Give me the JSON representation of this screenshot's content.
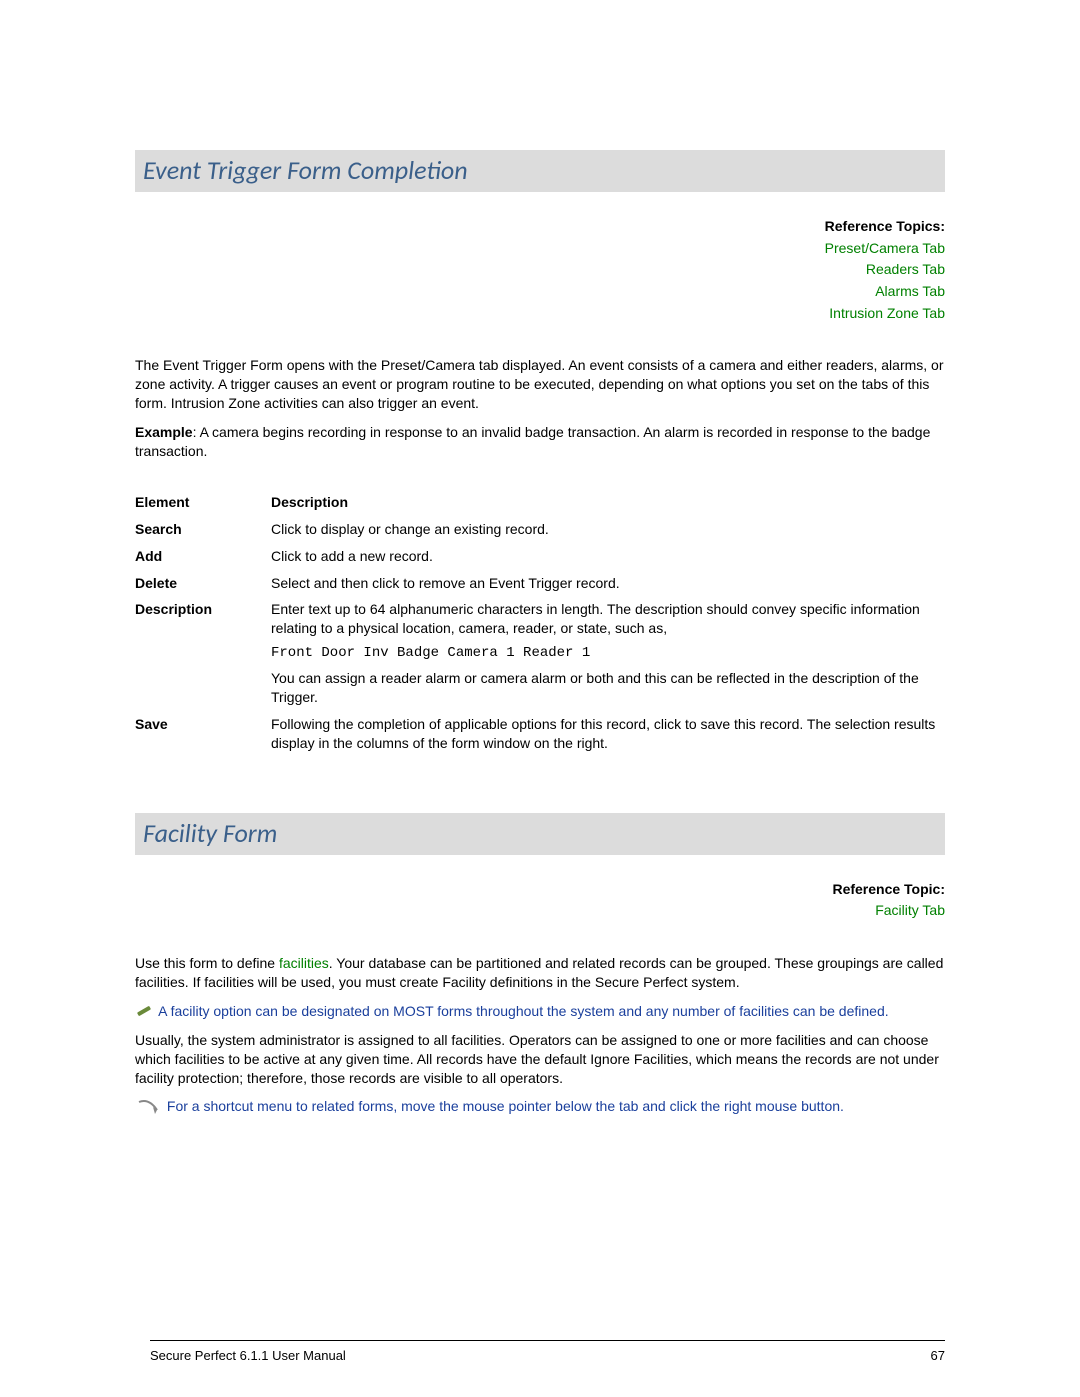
{
  "section1": {
    "heading": "Event Trigger Form Completion",
    "ref_label": "Reference Topics:",
    "ref_links": [
      "Preset/Camera Tab",
      "Readers Tab",
      "Alarms Tab",
      "Intrusion Zone Tab"
    ],
    "para1": "The Event Trigger Form opens with the Preset/Camera tab displayed. An event consists of a camera and either readers, alarms, or zone activity. A trigger causes an event or program routine to be executed, depending on what options you set on the tabs of this form. Intrusion Zone activities can also trigger an event.",
    "example_label": "Example",
    "example_text": ": A camera begins recording in response to an invalid badge transaction. An alarm is recorded in response to the badge transaction.",
    "table": {
      "header_element": "Element",
      "header_desc": "Description",
      "rows": [
        {
          "el": "Search",
          "desc": "Click to display or change an existing record."
        },
        {
          "el": "Add",
          "desc": "Click to add a new record."
        },
        {
          "el": "Delete",
          "desc": "Select and then click to remove an Event Trigger record."
        }
      ],
      "desc_row": {
        "el": "Description",
        "p1": "Enter text up to 64 alphanumeric characters in length. The description should convey specific information relating to a physical location, camera, reader, or state, such as,",
        "code": "Front Door Inv Badge Camera 1 Reader 1",
        "p2": "You can assign a reader alarm or camera alarm or both and this can be reflected in the description of the Trigger."
      },
      "save_row": {
        "el": "Save",
        "desc": "Following the completion of applicable options for this record, click to save this record. The selection results display in the columns of the form window on the right."
      }
    }
  },
  "section2": {
    "heading": "Facility Form",
    "ref_label": "Reference Topic:",
    "ref_links": [
      "Facility Tab"
    ],
    "para1_a": "Use this form to define ",
    "para1_link": "facilities",
    "para1_b": ". Your database can be partitioned and related records can be grouped. These groupings are called facilities. If facilities will be used, you must create Facility definitions in the Secure Perfect system.",
    "tip1": "A facility option can be designated on MOST forms throughout the system and any number of facilities can be defined.",
    "para2": "Usually, the system administrator is assigned to all facilities. Operators can be assigned to one or more facilities and can choose which facilities to be active at any given time. All records have the default Ignore Facilities, which means the records are not under facility protection; therefore, those records are visible to all operators.",
    "tip2": "For a shortcut menu to related forms, move the mouse pointer below the tab and click the right mouse button."
  },
  "footer": {
    "left": "Secure Perfect 6.1.1 User Manual",
    "right": "67"
  }
}
